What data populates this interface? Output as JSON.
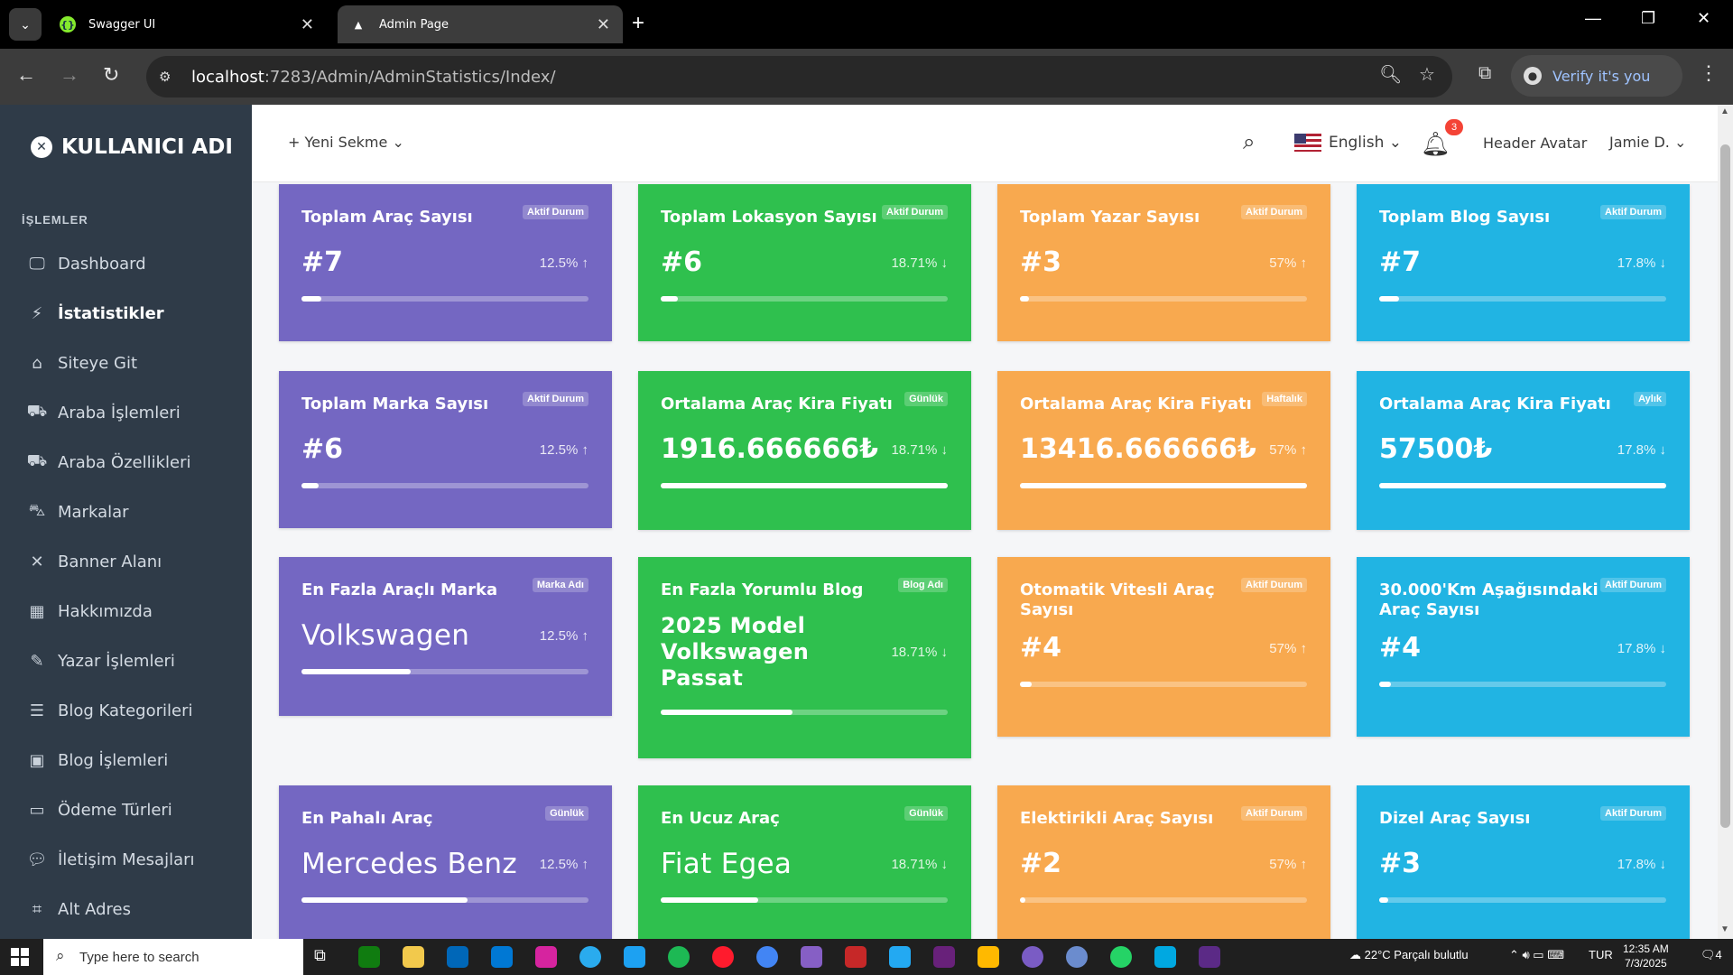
{
  "browser": {
    "tabs": [
      {
        "title": "Swagger UI",
        "active": false
      },
      {
        "title": "Admin Page",
        "active": true
      }
    ],
    "url_host": "localhost",
    "url_path": ":7283/Admin/AdminStatistics/Index/",
    "verify_label": "Verify it's you"
  },
  "sidebar": {
    "brand": "KULLANICI ADI",
    "section_title": "İŞLEMLER",
    "items": [
      {
        "label": "Dashboard",
        "icon": "monitor-icon"
      },
      {
        "label": "İstatistikler",
        "icon": "bolt-icon",
        "active": true
      },
      {
        "label": "Siteye Git",
        "icon": "home-icon"
      },
      {
        "label": "Araba İşlemleri",
        "icon": "car-icon"
      },
      {
        "label": "Araba Özellikleri",
        "icon": "car-side-icon"
      },
      {
        "label": "Markalar",
        "icon": "car-front-icon"
      },
      {
        "label": "Banner Alanı",
        "icon": "resize-icon"
      },
      {
        "label": "Hakkımızda",
        "icon": "building-icon"
      },
      {
        "label": "Yazar İşlemleri",
        "icon": "pencil-icon"
      },
      {
        "label": "Blog Kategorileri",
        "icon": "list-icon"
      },
      {
        "label": "Blog İşlemleri",
        "icon": "blog-icon"
      },
      {
        "label": "Ödeme Türleri",
        "icon": "money-icon"
      },
      {
        "label": "İletişim Mesajları",
        "icon": "comments-icon"
      },
      {
        "label": "Alt Adres",
        "icon": "crop-icon"
      }
    ]
  },
  "topbar": {
    "new_tab_label": "+ Yeni Sekme",
    "language": "English",
    "notification_count": "3",
    "avatar_alt": "Header Avatar",
    "username": "Jamie D."
  },
  "cards": [
    {
      "title": "Toplam Araç Sayısı",
      "badge": "Aktif Durum",
      "value": "#7",
      "pct": "12.5% ↑",
      "fill": 0.07,
      "color": "purple"
    },
    {
      "title": "Toplam Lokasyon Sayısı",
      "badge": "Aktif Durum",
      "value": "#6",
      "pct": "18.71% ↓",
      "fill": 0.06,
      "color": "green"
    },
    {
      "title": "Toplam Yazar Sayısı",
      "badge": "Aktif Durum",
      "value": "#3",
      "pct": "57% ↑",
      "fill": 0.03,
      "color": "orange"
    },
    {
      "title": "Toplam Blog Sayısı",
      "badge": "Aktif Durum",
      "value": "#7",
      "pct": "17.8% ↓",
      "fill": 0.07,
      "color": "blue"
    },
    {
      "title": "Toplam Marka Sayısı",
      "badge": "Aktif Durum",
      "value": "#6",
      "pct": "12.5% ↑",
      "fill": 0.06,
      "color": "purple"
    },
    {
      "title": "Ortalama Araç Kira Fiyatı",
      "badge": "Günlük",
      "value": "1916.666666₺",
      "pct": "18.71% ↓",
      "fill": 1.0,
      "color": "green"
    },
    {
      "title": "Ortalama Araç Kira Fiyatı",
      "badge": "Haftalık",
      "value": "13416.666666₺",
      "pct": "57% ↑",
      "fill": 1.0,
      "color": "orange"
    },
    {
      "title": "Ortalama Araç Kira Fiyatı",
      "badge": "Aylık",
      "value": "57500₺",
      "pct": "17.8% ↓",
      "fill": 1.0,
      "color": "blue"
    },
    {
      "title": "En Fazla Araçlı Marka",
      "badge": "Marka Adı",
      "value": "Volkswagen",
      "pct": "12.5% ↑",
      "fill": 0.38,
      "color": "purple"
    },
    {
      "title": "En Fazla Yorumlu Blog",
      "badge": "Blog Adı",
      "value": "2025 Model Volkswagen Passat",
      "pct": "18.71% ↓",
      "fill": 0.46,
      "color": "green"
    },
    {
      "title": "Otomatik Vitesli Araç Sayısı",
      "badge": "Aktif Durum",
      "value": "#4",
      "pct": "57% ↑",
      "fill": 0.04,
      "color": "orange"
    },
    {
      "title": "30.000'Km Aşağısındaki Araç Sayısı",
      "badge": "Aktif Durum",
      "value": "#4",
      "pct": "17.8% ↓",
      "fill": 0.04,
      "color": "blue"
    },
    {
      "title": "En Pahalı Araç",
      "badge": "Günlük",
      "value": "Mercedes Benz",
      "pct": "12.5% ↑",
      "fill": 0.58,
      "color": "purple"
    },
    {
      "title": "En Ucuz Araç",
      "badge": "Günlük",
      "value": "Fiat Egea",
      "pct": "18.71% ↓",
      "fill": 0.34,
      "color": "green"
    },
    {
      "title": "Elektirikli Araç Sayısı",
      "badge": "Aktif Durum",
      "value": "#2",
      "pct": "57% ↑",
      "fill": 0.02,
      "color": "orange"
    },
    {
      "title": "Dizel Araç Sayısı",
      "badge": "Aktif Durum",
      "value": "#3",
      "pct": "17.8% ↓",
      "fill": 0.03,
      "color": "blue"
    }
  ],
  "taskbar": {
    "search_placeholder": "Type here to search",
    "weather": "22°C  Parçalı bulutlu",
    "lang": "TUR",
    "time": "12:35 AM",
    "date": "7/3/2025",
    "notif": "4"
  }
}
